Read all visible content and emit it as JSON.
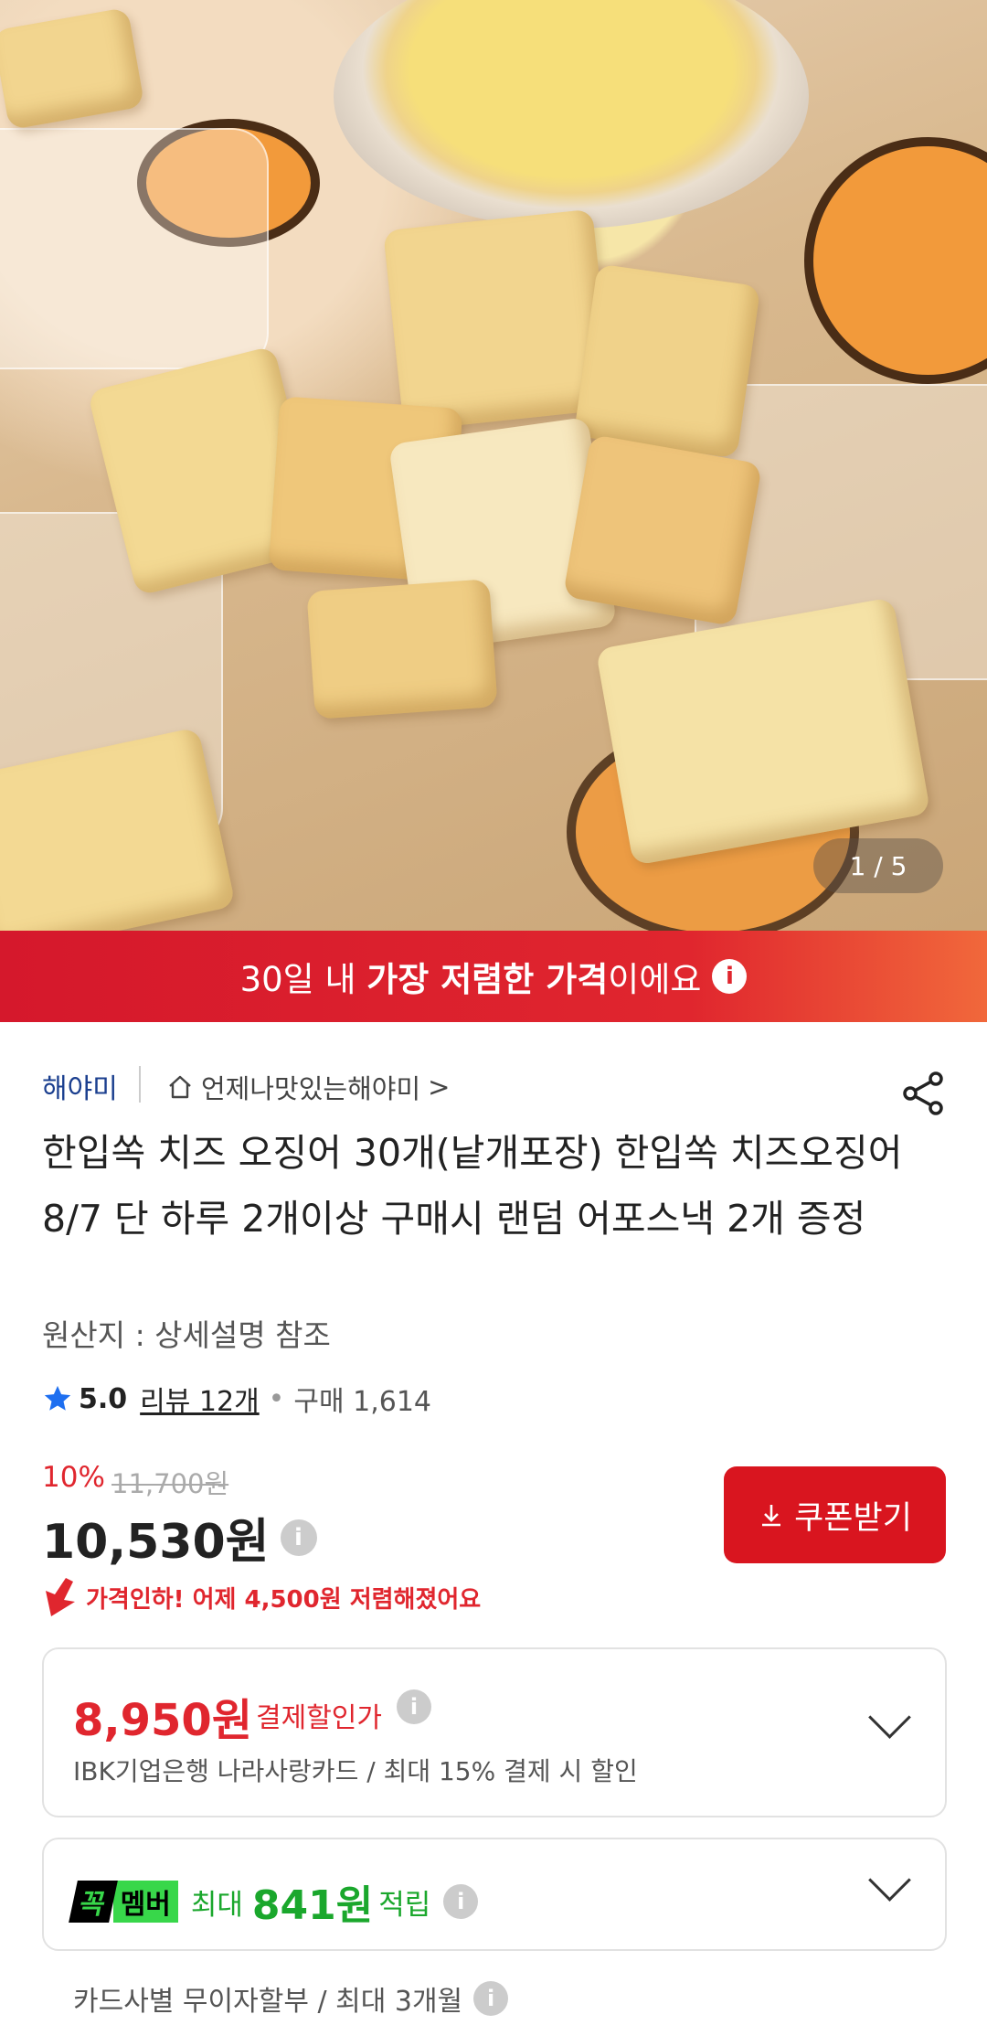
{
  "gallery": {
    "counter": "1 / 5"
  },
  "promo": {
    "prefix": "30일 내 ",
    "bold": "가장 저렴한 가격",
    "suffix": "이에요"
  },
  "seller": {
    "brand": "해야미",
    "store": "언제나맛있는해야미",
    "chevron": ">"
  },
  "product": {
    "title": "한입쏙 치즈 오징어 30개(낱개포장) 한입쏙 치즈오징어 8/7 단 하루 2개이상 구매시 랜덤 어포스낵 2개 증정",
    "origin": "원산지 : 상세설명 참조"
  },
  "rating": {
    "score": "5.0",
    "reviews": "리뷰 12개",
    "purchases": "구매 1,614"
  },
  "price": {
    "discount": "10%",
    "original": "11,700원",
    "current": "10,530원",
    "drop_note": "가격인하! 어제 4,500원 저렴해졌어요"
  },
  "coupon": {
    "label": "쿠폰받기"
  },
  "payment": {
    "price": "8,950원",
    "label": "결제할인가",
    "desc": "IBK기업은행 나라사랑카드 / 최대 15% 결제 시 할인"
  },
  "membership": {
    "badge_a": "꼭",
    "badge_b": "멤버",
    "text_a": "최대",
    "amount": "841원",
    "text_b": "적립"
  },
  "installment": {
    "text": "카드사별 무이자할부 / 최대 3개월"
  },
  "colors": {
    "accent": "#e0262e",
    "member": "#38d74a",
    "brand": "#1b3f8f"
  }
}
